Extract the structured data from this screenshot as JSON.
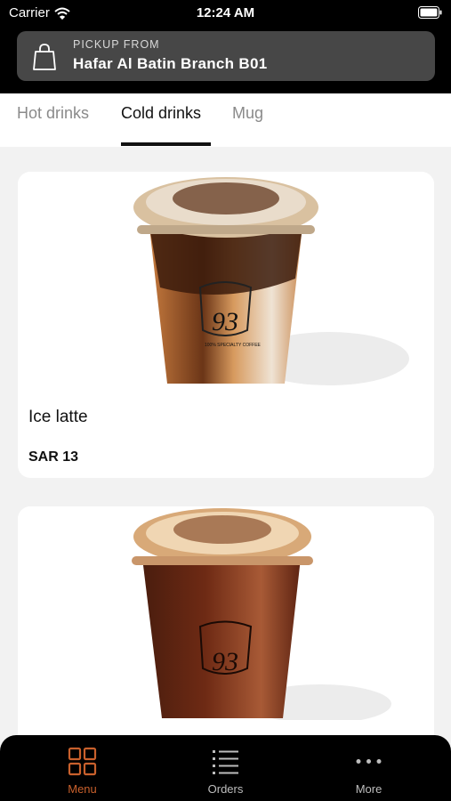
{
  "status_bar": {
    "carrier": "Carrier",
    "time": "12:24 AM"
  },
  "pickup": {
    "label": "PICKUP FROM",
    "branch": "Hafar Al Batin Branch B01"
  },
  "tabs": [
    {
      "label": "Hot drinks",
      "active": false
    },
    {
      "label": "Cold drinks",
      "active": true
    },
    {
      "label": "Mug",
      "active": false
    }
  ],
  "products": [
    {
      "name": "Ice latte",
      "price": "SAR 13",
      "logo": "93°",
      "image": "iced-latte-cup"
    },
    {
      "name": "",
      "price": "",
      "logo": "93°",
      "image": "iced-americano-cup"
    }
  ],
  "tab_bar": {
    "items": [
      {
        "label": "Menu",
        "icon": "grid-icon",
        "active": true
      },
      {
        "label": "Orders",
        "icon": "list-icon",
        "active": false
      },
      {
        "label": "More",
        "icon": "more-icon",
        "active": false
      }
    ]
  },
  "colors": {
    "accent": "#c8602c",
    "header_bg": "#000000",
    "pickup_bg": "#474747"
  }
}
